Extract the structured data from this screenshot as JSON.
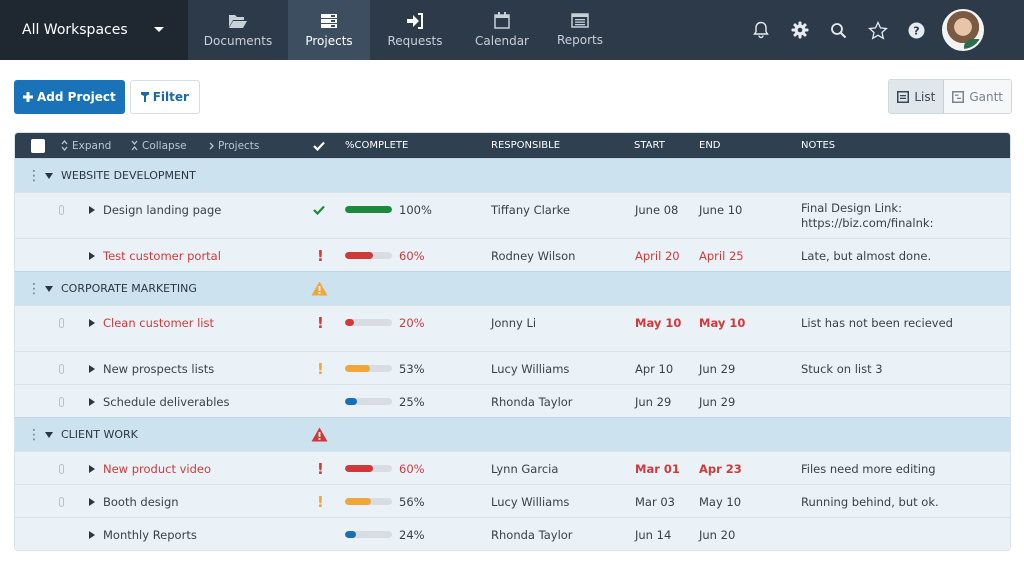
{
  "topbar": {
    "workspace": "All Workspaces",
    "nav": [
      {
        "label": "Documents",
        "icon": "folder-open-icon",
        "active": false
      },
      {
        "label": "Projects",
        "icon": "projects-stack-icon",
        "active": true
      },
      {
        "label": "Requests",
        "icon": "sign-in-arrow-icon",
        "active": false
      },
      {
        "label": "Calendar",
        "icon": "calendar-icon",
        "active": false
      },
      {
        "label": "Reports",
        "icon": "report-list-icon",
        "active": false
      }
    ],
    "icons": [
      "bell-icon",
      "gear-icon",
      "search-icon",
      "star-icon",
      "help-icon"
    ]
  },
  "toolbar": {
    "add_label": "Add Project",
    "filter_label": "Filter",
    "views": [
      {
        "label": "List",
        "active": true
      },
      {
        "label": "Gantt",
        "active": false
      }
    ]
  },
  "table": {
    "header": {
      "expand": "Expand",
      "collapse": "Collapse",
      "projects": "Projects",
      "complete": "%COMPLETE",
      "responsible": "RESPONSIBLE",
      "start": "START",
      "end": "END",
      "notes": "NOTES"
    },
    "colors": {
      "green": "#1b8a3f",
      "red": "#d0393a",
      "orange": "#f0a63a",
      "blue": "#1a6fb3"
    },
    "groups": [
      {
        "name": "WEBSITE DEVELOPMENT",
        "alert": "",
        "rows": [
          {
            "name": "Design landing page",
            "status": "done",
            "percent": 100,
            "percent_label": "100%",
            "responsible": "Tiffany Clarke",
            "start": "June 08",
            "end": "June 10",
            "notes": [
              "Final Design Link:",
              "https://biz.com/finalnk:"
            ],
            "attachment": true,
            "late": false,
            "overdue": false
          },
          {
            "name": "Test customer portal",
            "status": "late",
            "percent": 60,
            "percent_label": "60%",
            "responsible": "Rodney Wilson",
            "start": "April 20",
            "end": "April 25",
            "notes": [
              "Late, but almost done."
            ],
            "attachment": false,
            "late": true,
            "overdue": false
          }
        ]
      },
      {
        "name": "CORPORATE MARKETING",
        "alert": "warning",
        "rows": [
          {
            "name": "Clean customer list",
            "status": "late",
            "percent": 20,
            "percent_label": "20%",
            "responsible": "Jonny Li",
            "start": "May 10",
            "end": "May 10",
            "notes": [
              "List has not been recieved"
            ],
            "attachment": true,
            "late": true,
            "overdue": true
          },
          {
            "name": "New prospects lists",
            "status": "risk",
            "percent": 53,
            "percent_label": "53%",
            "responsible": "Lucy Williams",
            "start": "Apr 10",
            "end": "Jun 29",
            "notes": [
              "Stuck on list 3"
            ],
            "attachment": true,
            "late": false,
            "overdue": false
          },
          {
            "name": "Schedule deliverables",
            "status": "ok",
            "percent": 25,
            "percent_label": "25%",
            "responsible": "Rhonda Taylor",
            "start": "Jun 29",
            "end": "Jun 29",
            "notes": [],
            "attachment": true,
            "late": false,
            "overdue": false
          }
        ]
      },
      {
        "name": "CLIENT WORK",
        "alert": "danger",
        "rows": [
          {
            "name": "New product video",
            "status": "late",
            "percent": 60,
            "percent_label": "60%",
            "responsible": "Lynn Garcia",
            "start": "Mar 01",
            "end": "Apr 23",
            "notes": [
              "Files need more editing"
            ],
            "attachment": true,
            "late": true,
            "overdue": true
          },
          {
            "name": "Booth design",
            "status": "risk",
            "percent": 56,
            "percent_label": "56%",
            "responsible": "Lucy Williams",
            "start": "Mar 03",
            "end": "May 10",
            "notes": [
              "Running behind, but ok."
            ],
            "attachment": true,
            "late": false,
            "overdue": false
          },
          {
            "name": "Monthly Reports",
            "status": "ok",
            "percent": 24,
            "percent_label": "24%",
            "responsible": "Rhonda Taylor",
            "start": "Jun 14",
            "end": "Jun 20",
            "notes": [],
            "attachment": false,
            "late": false,
            "overdue": false
          }
        ]
      }
    ]
  }
}
